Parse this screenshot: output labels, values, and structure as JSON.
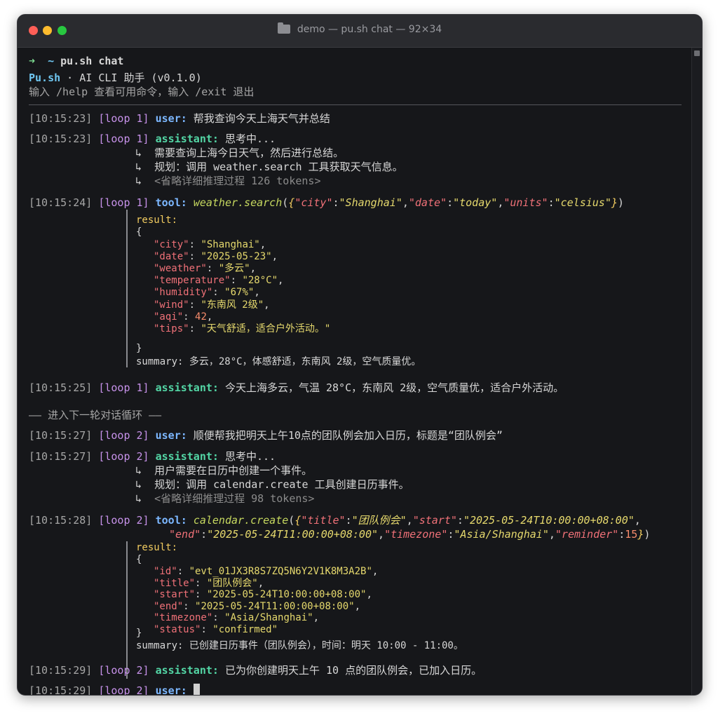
{
  "window": {
    "title": "demo — pu.sh chat — 92×34",
    "colors": {
      "red": "#ff5f57",
      "yellow": "#febc2e",
      "green": "#28c840"
    }
  },
  "prompt": {
    "arrow": "➜",
    "dir": "~",
    "command": "pu.sh chat"
  },
  "banner": {
    "name": "Pu.sh",
    "rest": " · AI CLI 助手 (v0.1.0)",
    "hint": "输入 /help 查看可用命令，输入 /exit 退出"
  },
  "log": {
    "l1": {
      "ts": "[10:15:23]",
      "loop": "[loop 1]",
      "role": "user:",
      "text": " 帮我查询今天上海天气并总结"
    },
    "l2": {
      "ts": "[10:15:23]",
      "loop": "[loop 1]",
      "role": "assistant:",
      "text": " 思考中...",
      "sub1": "↳  需要查询上海今日天气，然后进行总结。",
      "sub2": "↳  规划：调用 weather.search 工具获取天气信息。",
      "sub3_arrow": "↳  ",
      "sub3": "<省略详细推理过程 126 tokens>"
    },
    "l3": {
      "ts": "[10:15:24]",
      "loop": "[loop 1]",
      "role": "tool:",
      "fn": "weather.search",
      "args": [
        "(",
        "{",
        "\"city\"",
        ":",
        "\"Shanghai\"",
        ",",
        "\"date\"",
        ":",
        "\"today\"",
        ",",
        "\"units\"",
        ":",
        "\"celsius\"",
        "}",
        ")"
      ],
      "result_label": "result:",
      "open": "{",
      "fields": [
        {
          "key": "\"city\"",
          "colon": ": ",
          "val": "\"Shanghai\"",
          "end": ","
        },
        {
          "key": "\"date\"",
          "colon": ": ",
          "val": "\"2025-05-23\"",
          "end": ","
        },
        {
          "key": "\"weather\"",
          "colon": ": ",
          "val": "\"多云\"",
          "end": ","
        },
        {
          "key": "\"temperature\"",
          "colon": ": ",
          "val": "\"28°C\"",
          "end": ","
        },
        {
          "key": "\"humidity\"",
          "colon": ": ",
          "val": "\"67%\"",
          "end": ","
        },
        {
          "key": "\"wind\"",
          "colon": ": ",
          "val": "\"东南风 2级\"",
          "end": ","
        },
        {
          "key": "\"aqi\"",
          "colon": ": ",
          "val": "42",
          "end": ","
        },
        {
          "key": "\"tips\"",
          "colon": ": ",
          "val": "\"天气舒适，适合户外活动。\"",
          "end": ""
        }
      ],
      "close": "}",
      "summary": "summary: 多云，28°C，体感舒适，东南风 2级，空气质量优。"
    },
    "l4": {
      "ts": "[10:15:25]",
      "loop": "[loop 1]",
      "role": "assistant:",
      "text": " 今天上海多云，气温 28°C，东南风 2级，空气质量优，适合户外活动。"
    },
    "divider": "—— 进入下一轮对话循环 ——",
    "l5": {
      "ts": "[10:15:27]",
      "loop": "[loop 2]",
      "role": "user:",
      "text": " 顺便帮我把明天上午10点的团队例会加入日历，标题是“团队例会”"
    },
    "l6": {
      "ts": "[10:15:27]",
      "loop": "[loop 2]",
      "role": "assistant:",
      "text": " 思考中...",
      "sub1": "↳  用户需要在日历中创建一个事件。",
      "sub2": "↳  规划：调用 calendar.create 工具创建日历事件。",
      "sub3_arrow": "↳  ",
      "sub3": "<省略详细推理过程 98 tokens>"
    },
    "l7": {
      "ts": "[10:15:28]",
      "loop": "[loop 2]",
      "role": "tool:",
      "fn": "calendar.create",
      "args1": [
        "(",
        "{",
        "\"title\"",
        ":",
        "\"团队例会\"",
        ",",
        "\"start\"",
        ":",
        "\"2025-05-24T10:00:00+08:00\"",
        ","
      ],
      "args2": [
        "\"end\"",
        ":",
        "\"2025-05-24T11:00:00+08:00\"",
        ",",
        "\"timezone\"",
        ":",
        "\"Asia/Shanghai\"",
        ",",
        "\"reminder\"",
        ":",
        "15",
        "}",
        ")"
      ],
      "result_label": "result:",
      "open": "{",
      "fields": [
        {
          "key": "\"id\"",
          "colon": ": ",
          "val": "\"evt_01JX3R8S7ZQ5N6Y2V1K8M3A2B\"",
          "end": ","
        },
        {
          "key": "\"title\"",
          "colon": ": ",
          "val": "\"团队例会\"",
          "end": ","
        },
        {
          "key": "\"start\"",
          "colon": ": ",
          "val": "\"2025-05-24T10:00:00+08:00\"",
          "end": ","
        },
        {
          "key": "\"end\"",
          "colon": ": ",
          "val": "\"2025-05-24T11:00:00+08:00\"",
          "end": ","
        },
        {
          "key": "\"timezone\"",
          "colon": ": ",
          "val": "\"Asia/Shanghai\"",
          "end": ","
        },
        {
          "key": "\"status\"",
          "colon": ": ",
          "val": "\"confirmed\"",
          "end": ""
        }
      ],
      "close": "}",
      "summary": "summary: 已创建日历事件（团队例会），时间：明天 10:00 - 11:00。"
    },
    "l8": {
      "ts": "[10:15:29]",
      "loop": "[loop 2]",
      "role": "assistant:",
      "text": " 已为你创建明天上午 10 点的团队例会，已加入日历。"
    },
    "l9": {
      "ts": "[10:15:29]",
      "loop": "[loop 2]",
      "role": "user:",
      "text": " "
    }
  }
}
